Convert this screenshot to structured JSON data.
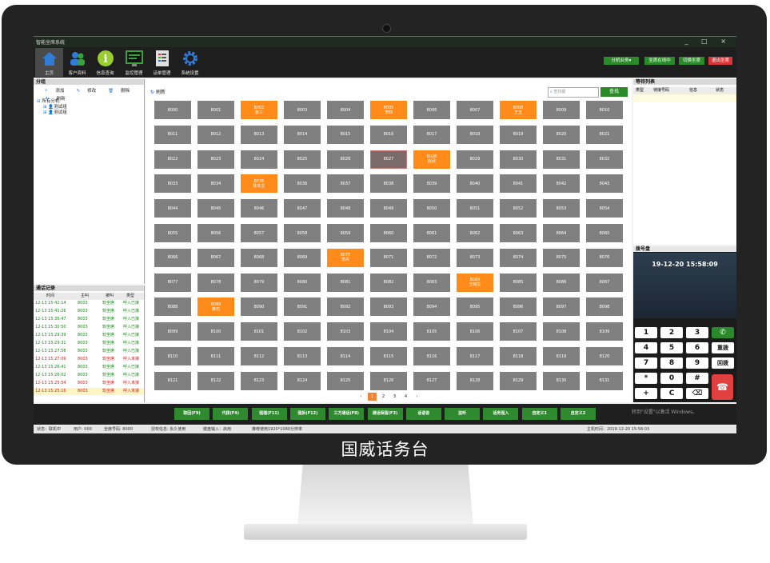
{
  "app": {
    "title": "智能坐席系统",
    "window_controls": "_ □ ×"
  },
  "toolbar": {
    "items": [
      {
        "label": "主页",
        "icon": "home-icon",
        "color": "#2f7bd6"
      },
      {
        "label": "客户资料",
        "icon": "users-icon",
        "color": "#2f7bd6"
      },
      {
        "label": "信息查询",
        "icon": "info-icon",
        "color": "#9acd32"
      },
      {
        "label": "监控管理",
        "icon": "monitor-icon",
        "color": "#3aa040"
      },
      {
        "label": "话单管理",
        "icon": "report-icon",
        "color": "#e0e0e0"
      },
      {
        "label": "系统设置",
        "icon": "gear-icon",
        "color": "#2f7bd6"
      }
    ],
    "right_buttons": [
      "分机业务▾",
      "坐席在线中",
      "切换坐席",
      "退出坐席"
    ]
  },
  "groups": {
    "title": "分组",
    "actions": [
      "添加",
      "修改",
      "删除",
      "刷新"
    ],
    "tree": [
      "所有分机",
      "测试组",
      "测试组"
    ]
  },
  "calls": {
    "title": "通话记录",
    "columns": [
      "时间",
      "主叫",
      "被叫",
      "类型"
    ],
    "rows": [
      {
        "time": "12-13 15:42:14",
        "caller": "8003",
        "callee": "软坐席",
        "type": "呼入已接",
        "color": "#1a8a1a"
      },
      {
        "time": "12-13 15:41:26",
        "caller": "8003",
        "callee": "软坐席",
        "type": "呼入已接",
        "color": "#1a8a1a"
      },
      {
        "time": "12-13 15:36:47",
        "caller": "8003",
        "callee": "软坐席",
        "type": "呼入已接",
        "color": "#1a8a1a"
      },
      {
        "time": "12-13 15:30:50",
        "caller": "8003",
        "callee": "软坐席",
        "type": "呼入已接",
        "color": "#1a8a1a"
      },
      {
        "time": "12-13 15:29:39",
        "caller": "8003",
        "callee": "软坐席",
        "type": "呼入已接",
        "color": "#1a8a1a"
      },
      {
        "time": "12-13 15:29:31",
        "caller": "8003",
        "callee": "软坐席",
        "type": "呼入已接",
        "color": "#1a8a1a"
      },
      {
        "time": "12-13 15:27:58",
        "caller": "8003",
        "callee": "软坐席",
        "type": "呼入已接",
        "color": "#1a8a1a"
      },
      {
        "time": "12-13 15:27:09",
        "caller": "8003",
        "callee": "软坐席",
        "type": "呼入未接",
        "color": "#d42020"
      },
      {
        "time": "12-13 15:26:41",
        "caller": "8003",
        "callee": "软坐席",
        "type": "呼入已接",
        "color": "#1a8a1a"
      },
      {
        "time": "12-13 15:26:02",
        "caller": "8003",
        "callee": "软坐席",
        "type": "呼入已接",
        "color": "#1a8a1a"
      },
      {
        "time": "12-13 15:25:54",
        "caller": "8003",
        "callee": "软坐席",
        "type": "呼入未接",
        "color": "#d42020"
      },
      {
        "time": "12-13 15:25:16",
        "caller": "8003",
        "callee": "软坐席",
        "type": "呼入未接",
        "color": "#d42020"
      }
    ]
  },
  "extensions": {
    "refresh_label": "刷新",
    "search_placeholder": "查找键",
    "search_button": "查找",
    "busy_color": "#ff8c1a",
    "idle_color": "#808080",
    "rows": [
      [
        [
          "8000",
          ""
        ],
        [
          "8001",
          ""
        ],
        [
          "8002",
          "张三",
          "busy"
        ],
        [
          "8003",
          ""
        ],
        [
          "8004",
          ""
        ],
        [
          "8005",
          "李四",
          "busy"
        ],
        [
          "8006",
          ""
        ],
        [
          "8007",
          ""
        ],
        [
          "8008",
          "王五",
          "busy"
        ],
        [
          "8009",
          ""
        ],
        [
          "8010",
          ""
        ]
      ],
      [
        [
          "8011",
          ""
        ],
        [
          "8012",
          ""
        ],
        [
          "8013",
          ""
        ],
        [
          "8014",
          ""
        ],
        [
          "8015",
          ""
        ],
        [
          "8016",
          ""
        ],
        [
          "8017",
          ""
        ],
        [
          "8018",
          ""
        ],
        [
          "8019",
          ""
        ],
        [
          "8020",
          ""
        ],
        [
          "8021",
          ""
        ]
      ],
      [
        [
          "8022",
          ""
        ],
        [
          "8023",
          ""
        ],
        [
          "8024",
          ""
        ],
        [
          "8025",
          ""
        ],
        [
          "8026",
          ""
        ],
        [
          "8027",
          "",
          "hl"
        ],
        [
          "8028",
          "赵武",
          "busy"
        ],
        [
          "8029",
          ""
        ],
        [
          "8030",
          ""
        ],
        [
          "8031",
          ""
        ],
        [
          "8032",
          ""
        ]
      ],
      [
        [
          "8033",
          ""
        ],
        [
          "8034",
          ""
        ],
        [
          "8035",
          "陈先生",
          "busy"
        ],
        [
          "8036",
          ""
        ],
        [
          "8037",
          ""
        ],
        [
          "8038",
          ""
        ],
        [
          "8039",
          ""
        ],
        [
          "8040",
          ""
        ],
        [
          "8041",
          ""
        ],
        [
          "8042",
          ""
        ],
        [
          "8043",
          ""
        ]
      ],
      [
        [
          "8044",
          ""
        ],
        [
          "8045",
          ""
        ],
        [
          "8046",
          ""
        ],
        [
          "8047",
          ""
        ],
        [
          "8048",
          ""
        ],
        [
          "8049",
          ""
        ],
        [
          "8050",
          ""
        ],
        [
          "8051",
          ""
        ],
        [
          "8052",
          ""
        ],
        [
          "8053",
          ""
        ],
        [
          "8054",
          ""
        ]
      ],
      [
        [
          "8055",
          ""
        ],
        [
          "8056",
          ""
        ],
        [
          "8057",
          ""
        ],
        [
          "8058",
          ""
        ],
        [
          "8059",
          ""
        ],
        [
          "8060",
          ""
        ],
        [
          "8061",
          ""
        ],
        [
          "8062",
          ""
        ],
        [
          "8063",
          ""
        ],
        [
          "8064",
          ""
        ],
        [
          "8065",
          ""
        ]
      ],
      [
        [
          "8066",
          ""
        ],
        [
          "8067",
          ""
        ],
        [
          "8068",
          ""
        ],
        [
          "8069",
          ""
        ],
        [
          "8070",
          "李丹",
          "busy"
        ],
        [
          "8071",
          ""
        ],
        [
          "8072",
          ""
        ],
        [
          "8073",
          ""
        ],
        [
          "8074",
          ""
        ],
        [
          "8075",
          ""
        ],
        [
          "8076",
          ""
        ]
      ],
      [
        [
          "8077",
          ""
        ],
        [
          "8078",
          ""
        ],
        [
          "8079",
          ""
        ],
        [
          "8080",
          ""
        ],
        [
          "8081",
          ""
        ],
        [
          "8082",
          ""
        ],
        [
          "8083",
          ""
        ],
        [
          "8084",
          "王晓生",
          "busy"
        ],
        [
          "8085",
          ""
        ],
        [
          "8086",
          ""
        ],
        [
          "8087",
          ""
        ]
      ],
      [
        [
          "8088",
          ""
        ],
        [
          "8089",
          "黄石",
          "busy"
        ],
        [
          "8090",
          ""
        ],
        [
          "8091",
          ""
        ],
        [
          "8092",
          ""
        ],
        [
          "8093",
          ""
        ],
        [
          "8094",
          ""
        ],
        [
          "8095",
          ""
        ],
        [
          "8096",
          ""
        ],
        [
          "8097",
          ""
        ],
        [
          "8098",
          ""
        ]
      ],
      [
        [
          "8099",
          ""
        ],
        [
          "8100",
          ""
        ],
        [
          "8101",
          ""
        ],
        [
          "8102",
          ""
        ],
        [
          "8103",
          ""
        ],
        [
          "8104",
          ""
        ],
        [
          "8105",
          ""
        ],
        [
          "8106",
          ""
        ],
        [
          "8107",
          ""
        ],
        [
          "8108",
          ""
        ],
        [
          "8109",
          ""
        ]
      ],
      [
        [
          "8110",
          ""
        ],
        [
          "8111",
          ""
        ],
        [
          "8112",
          ""
        ],
        [
          "8113",
          ""
        ],
        [
          "8114",
          ""
        ],
        [
          "8115",
          ""
        ],
        [
          "8116",
          ""
        ],
        [
          "8117",
          ""
        ],
        [
          "8118",
          ""
        ],
        [
          "8119",
          ""
        ],
        [
          "8120",
          ""
        ]
      ],
      [
        [
          "8121",
          ""
        ],
        [
          "8122",
          ""
        ],
        [
          "8123",
          ""
        ],
        [
          "8124",
          ""
        ],
        [
          "8125",
          ""
        ],
        [
          "8126",
          ""
        ],
        [
          "8127",
          ""
        ],
        [
          "8128",
          ""
        ],
        [
          "8129",
          ""
        ],
        [
          "8130",
          ""
        ],
        [
          "8131",
          ""
        ]
      ]
    ],
    "pages": [
      "‹",
      "1",
      "2",
      "3",
      "4",
      "›"
    ],
    "current_page": "1"
  },
  "waiting": {
    "title": "等待列表",
    "columns": [
      "类型",
      "待接号码",
      "信息",
      "状态"
    ]
  },
  "dialpad": {
    "title": "拨号盘",
    "datetime": "19-12-20 15:58:09",
    "keys": [
      "1",
      "2",
      "3",
      "4",
      "5",
      "6",
      "7",
      "8",
      "9",
      "*",
      "0",
      "#",
      "+",
      "C"
    ],
    "side_keys": [
      "重拨",
      "回拨"
    ],
    "call_icon": "phone-icon",
    "hangup_icon": "hangup-icon",
    "backspace_icon": "backspace-icon"
  },
  "function_buttons": [
    "取回(F9)",
    "代拨(F4)",
    "强插(F11)",
    "强拆(F12)",
    "三方通话(F8)",
    "通话保留(F3)",
    "话语音",
    "监听",
    "话务强入",
    "自定义1",
    "自定义2"
  ],
  "activation_hint": "转到\"设置\"以激活 Windows。",
  "status": {
    "state": "状态：联机中",
    "user": "用户: 000",
    "seat": "坐席号码: 8000",
    "license": "授权信息: 永久使用",
    "keyboard": "键盘输入：启用",
    "resolution": "推荐使用1920*1080分辨率",
    "host_time": "主机时间：2019-12-20 15:58:03"
  },
  "caption": "国威话务台"
}
